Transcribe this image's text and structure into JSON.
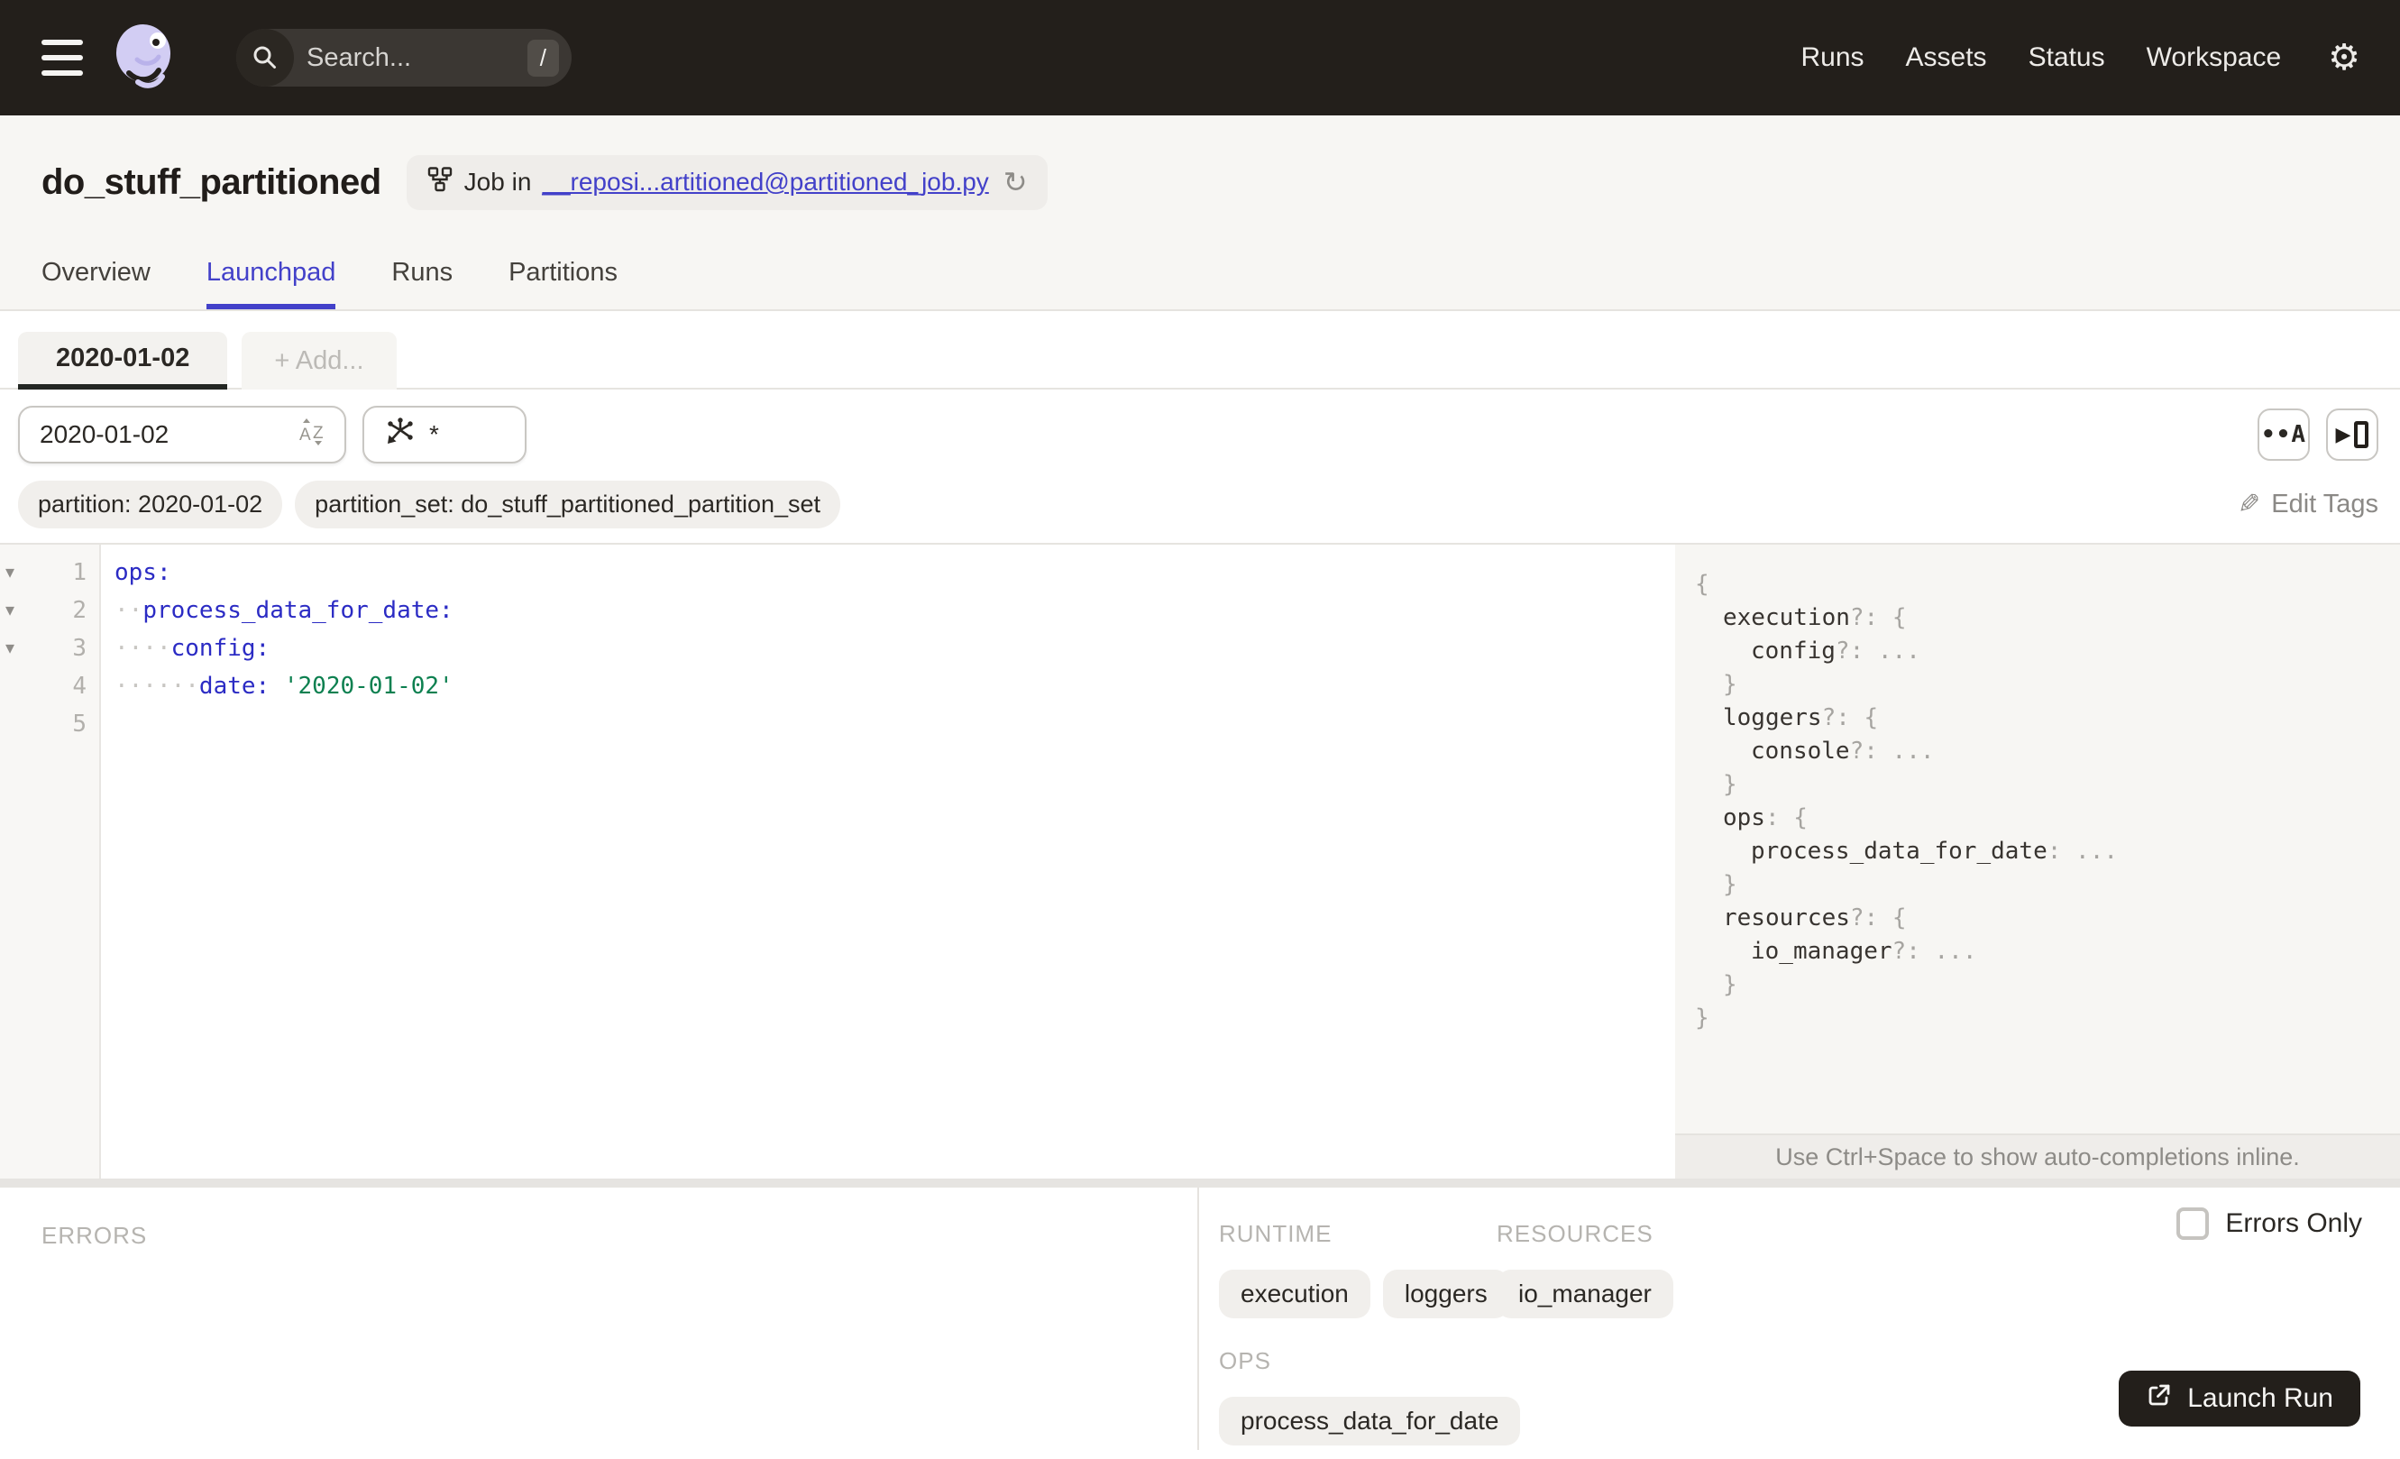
{
  "colors": {
    "accent": "#4341c9",
    "topbar_bg": "#231f1b",
    "yaml_key_blue": "#2b2bc4",
    "yaml_string_green": "#0d8050",
    "panel_bg": "#f7f6f3",
    "active_config_tab_underline": "#232723",
    "logo_lavender": "#d2cdf3"
  },
  "topbar": {
    "search_placeholder": "Search...",
    "search_shortcut": "/",
    "nav": [
      {
        "label": "Runs"
      },
      {
        "label": "Assets"
      },
      {
        "label": "Status"
      },
      {
        "label": "Workspace"
      }
    ]
  },
  "header": {
    "title": "do_stuff_partitioned",
    "job_pill": {
      "prefix": "Job in",
      "link": "__reposi...artitioned@partitioned_job.py"
    },
    "tabs": [
      {
        "label": "Overview"
      },
      {
        "label": "Launchpad"
      },
      {
        "label": "Runs"
      },
      {
        "label": "Partitions"
      }
    ]
  },
  "launchpad": {
    "config_tab": "2020-01-02",
    "add_tab_label": "+ Add...",
    "partition_select_value": "2020-01-02",
    "op_select_value": "*",
    "whitespace_button_glyph": "••A",
    "tags": [
      {
        "label": "partition: 2020-01-02"
      },
      {
        "label": "partition_set: do_stuff_partitioned_partition_set"
      }
    ],
    "edit_tags_label": "Edit Tags"
  },
  "editor": {
    "lines": [
      {
        "num": "1",
        "fold": "▾",
        "code": [
          {
            "s": "key",
            "t": "ops:"
          }
        ]
      },
      {
        "num": "2",
        "fold": "▾",
        "code": [
          {
            "s": "ws",
            "t": "··"
          },
          {
            "s": "key",
            "t": "process_data_for_date:"
          }
        ]
      },
      {
        "num": "3",
        "fold": "▾",
        "code": [
          {
            "s": "ws",
            "t": "····"
          },
          {
            "s": "key",
            "t": "config:"
          }
        ]
      },
      {
        "num": "4",
        "fold": "",
        "code": [
          {
            "s": "ws",
            "t": "······"
          },
          {
            "s": "key",
            "t": "date:"
          },
          {
            "s": "plain",
            "t": " "
          },
          {
            "s": "str",
            "t": "'2020-01-02'"
          }
        ]
      },
      {
        "num": "5",
        "fold": "",
        "code": []
      }
    ]
  },
  "schema": {
    "lines": [
      {
        "indent": 0,
        "name": "",
        "punct": "{"
      },
      {
        "indent": 1,
        "name": "execution",
        "punct": "?: {"
      },
      {
        "indent": 2,
        "name": "config",
        "punct": "?: ..."
      },
      {
        "indent": 1,
        "name": "",
        "punct": "}"
      },
      {
        "indent": 1,
        "name": "loggers",
        "punct": "?: {"
      },
      {
        "indent": 2,
        "name": "console",
        "punct": "?: ..."
      },
      {
        "indent": 1,
        "name": "",
        "punct": "}"
      },
      {
        "indent": 1,
        "name": "ops",
        "punct": ": {"
      },
      {
        "indent": 2,
        "name": "process_data_for_date",
        "punct": ": ..."
      },
      {
        "indent": 1,
        "name": "",
        "punct": "}"
      },
      {
        "indent": 1,
        "name": "resources",
        "punct": "?: {"
      },
      {
        "indent": 2,
        "name": "io_manager",
        "punct": "?: ..."
      },
      {
        "indent": 1,
        "name": "",
        "punct": "}"
      },
      {
        "indent": 0,
        "name": "",
        "punct": "}"
      }
    ],
    "hint": "Use Ctrl+Space to show auto-completions inline."
  },
  "bottom": {
    "errors_label": "ERRORS",
    "runtime_label": "RUNTIME",
    "resources_label": "RESOURCES",
    "ops_label": "OPS",
    "runtime_chips": [
      "execution",
      "loggers"
    ],
    "resources_chips": [
      "io_manager"
    ],
    "ops_chips": [
      "process_data_for_date"
    ],
    "errors_only_label": "Errors Only",
    "launch_button_label": "Launch Run"
  }
}
